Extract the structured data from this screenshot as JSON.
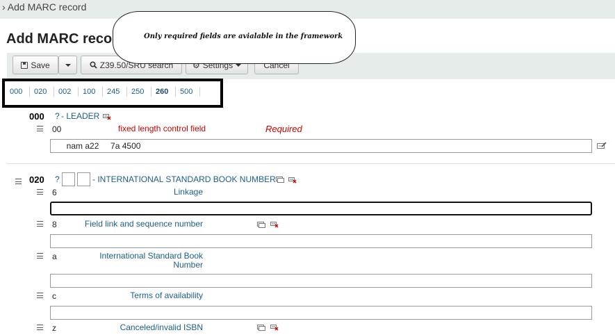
{
  "breadcrumb": "› Add MARC record",
  "page_title": "Add MARC record",
  "callout_note": "Only required fields are avialable in the framework",
  "toolbar": {
    "save_label": "Save",
    "z3950_label": "Z39.50/SRU search",
    "settings_label": "Settings",
    "cancel_label": "Cancel"
  },
  "tag_nav": [
    "000",
    "020",
    "002",
    "100",
    "245",
    "250",
    "260",
    "500"
  ],
  "tag_nav_active": "260",
  "field_000": {
    "tag": "000",
    "help": "?",
    "desc": "- LEADER",
    "code": "00",
    "label": "fixed length control field",
    "required_note": "Required",
    "value": "     nam a22     7a 4500"
  },
  "field_020": {
    "tag": "020",
    "help": "?",
    "desc": "- INTERNATIONAL STANDARD BOOK NUMBER",
    "subfields": [
      {
        "code": "6",
        "label": "Linkage",
        "value": ""
      },
      {
        "code": "8",
        "label": "Field link and sequence number",
        "value": ""
      },
      {
        "code": "a",
        "label": "International Standard Book Number",
        "value": ""
      },
      {
        "code": "c",
        "label": "Terms of availability",
        "value": ""
      },
      {
        "code": "z",
        "label": "Canceled/invalid ISBN",
        "value": ""
      }
    ]
  },
  "icons": {
    "save": "floppy-disk-icon",
    "search": "magnifier-icon",
    "settings": "gear-icon",
    "clone": "clone-field-icon",
    "delete": "delete-field-icon",
    "edit": "edit-plugin-icon",
    "drag": "drag-handle-icon"
  }
}
